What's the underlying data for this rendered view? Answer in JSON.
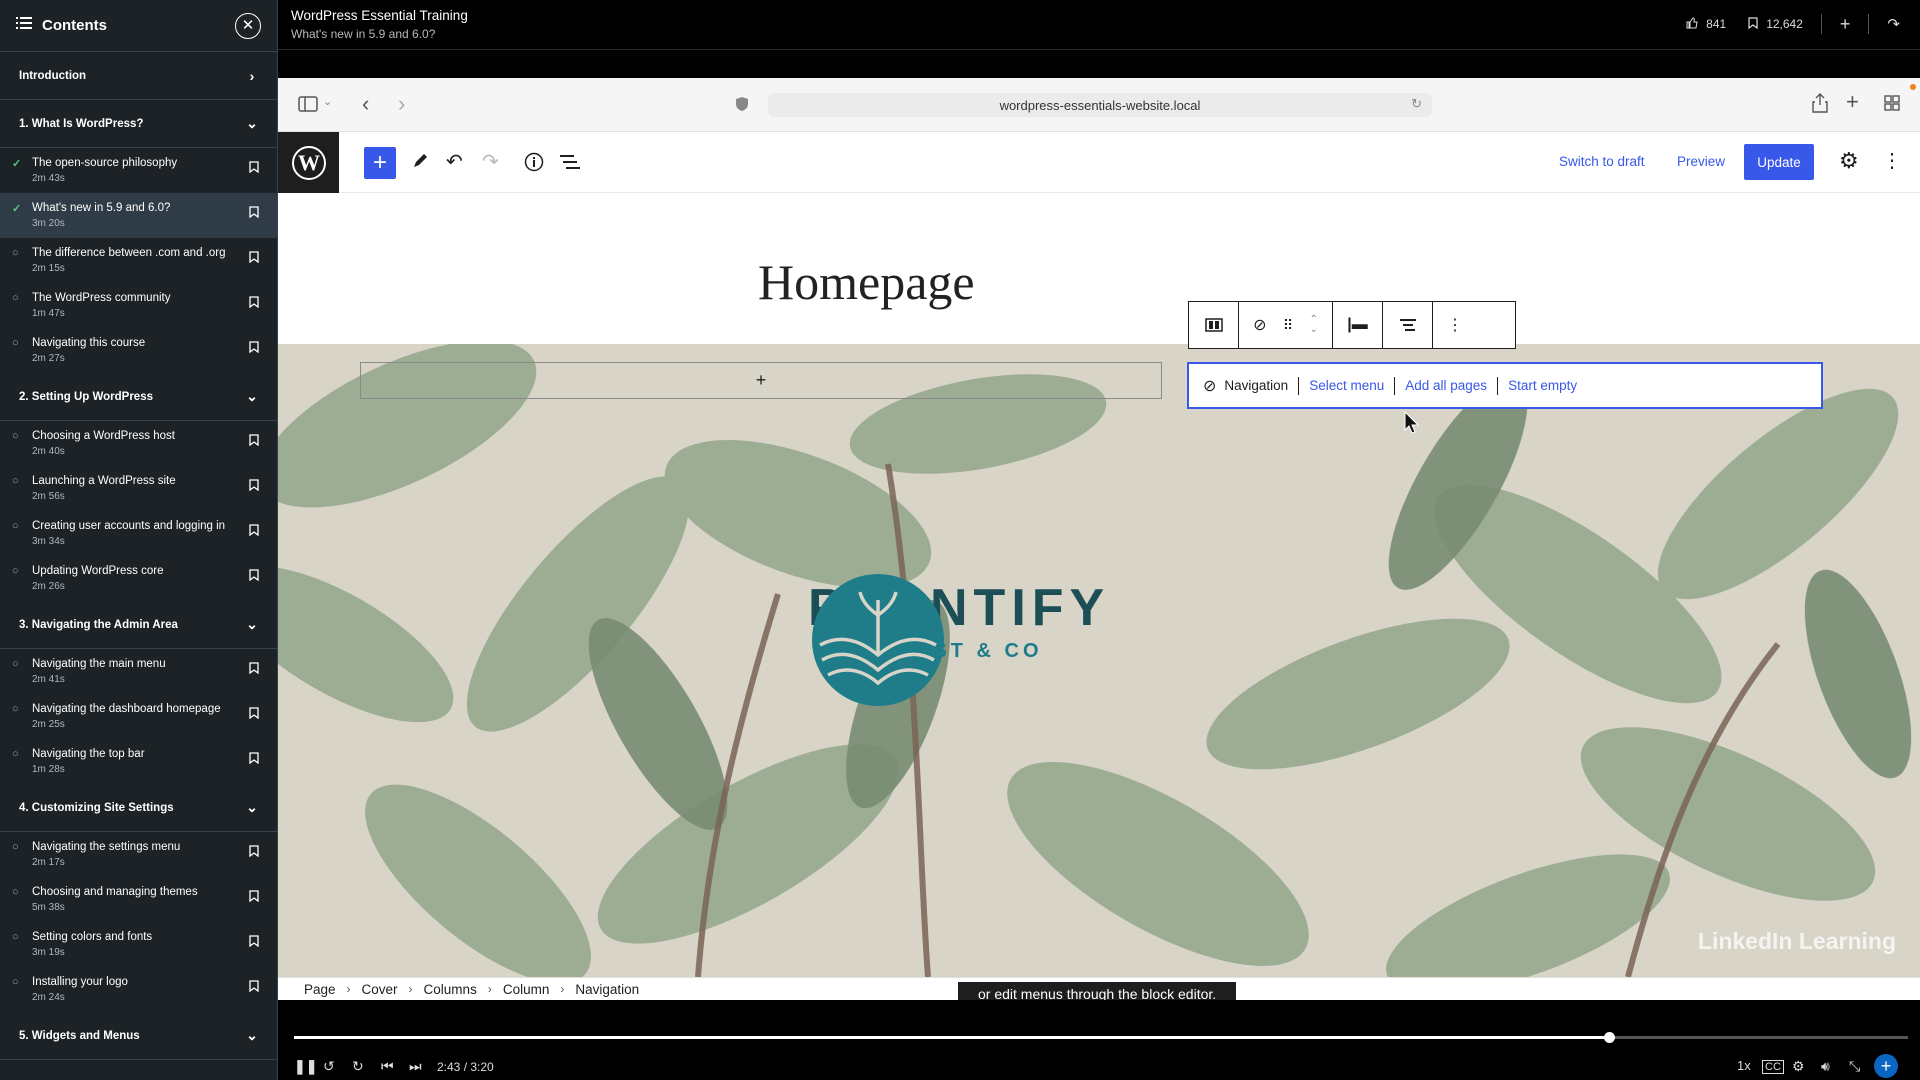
{
  "sidebar": {
    "title": "Contents",
    "intro": "Introduction",
    "chapters": [
      {
        "label": "1. What Is WordPress?",
        "lessons": [
          {
            "name": "The open-source philosophy",
            "dur": "2m 43s",
            "done": true
          },
          {
            "name": "What's new in 5.9 and 6.0?",
            "dur": "3m 20s",
            "done": true,
            "active": true
          },
          {
            "name": "The difference between .com and .org",
            "dur": "2m 15s"
          },
          {
            "name": "The WordPress community",
            "dur": "1m 47s"
          },
          {
            "name": "Navigating this course",
            "dur": "2m 27s"
          }
        ]
      },
      {
        "label": "2. Setting Up WordPress",
        "lessons": [
          {
            "name": "Choosing a WordPress host",
            "dur": "2m 40s"
          },
          {
            "name": "Launching a WordPress site",
            "dur": "2m 56s"
          },
          {
            "name": "Creating user accounts and logging in",
            "dur": "3m 34s"
          },
          {
            "name": "Updating WordPress core",
            "dur": "2m 26s"
          }
        ]
      },
      {
        "label": "3. Navigating the Admin Area",
        "lessons": [
          {
            "name": "Navigating the main menu",
            "dur": "2m 41s"
          },
          {
            "name": "Navigating the dashboard homepage",
            "dur": "2m 25s"
          },
          {
            "name": "Navigating the top bar",
            "dur": "1m 28s"
          }
        ]
      },
      {
        "label": "4. Customizing Site Settings",
        "lessons": [
          {
            "name": "Navigating the settings menu",
            "dur": "2m 17s"
          },
          {
            "name": "Choosing and managing themes",
            "dur": "5m 38s"
          },
          {
            "name": "Setting colors and fonts",
            "dur": "3m 19s"
          },
          {
            "name": "Installing your logo",
            "dur": "2m 24s"
          }
        ]
      },
      {
        "label": "5. Widgets and Menus",
        "lessons": []
      }
    ]
  },
  "topbar": {
    "course": "WordPress Essential Training",
    "video": "What's new in 5.9 and 6.0?",
    "likes": "841",
    "saves": "12,642"
  },
  "browser": {
    "url": "wordpress-essentials-website.local"
  },
  "editor": {
    "switch_draft": "Switch to draft",
    "preview": "Preview",
    "update": "Update",
    "page_title": "Homepage",
    "nav_label": "Navigation",
    "select_menu": "Select menu",
    "add_all_pages": "Add all pages",
    "start_empty": "Start empty",
    "logo_name": "PLANTIFY",
    "logo_tag": "FLORIST & CO",
    "breadcrumb": [
      "Page",
      "Cover",
      "Columns",
      "Column",
      "Navigation"
    ]
  },
  "video": {
    "caption": "or edit menus through the block editor.",
    "watermark": "LinkedIn Learning",
    "time": "2:43 / 3:20",
    "progress": 0.815,
    "speed": "1x",
    "accent": "#0a66c2"
  }
}
